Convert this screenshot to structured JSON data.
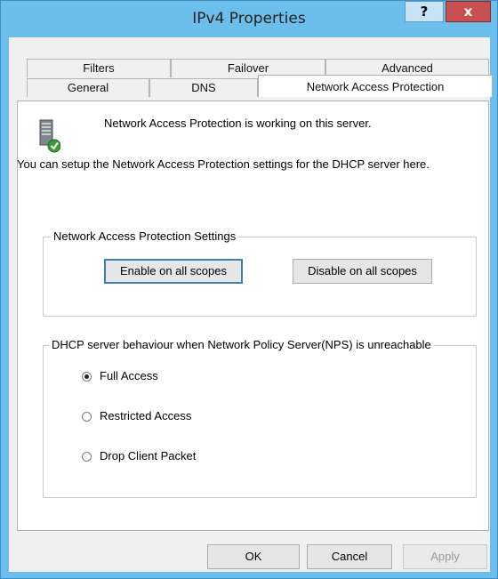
{
  "window": {
    "title": "IPv4 Properties",
    "help_label": "?",
    "close_label": "x"
  },
  "tabs": {
    "back": [
      {
        "label": "Filters"
      },
      {
        "label": "Failover"
      },
      {
        "label": "Advanced"
      }
    ],
    "front": [
      {
        "label": "General"
      },
      {
        "label": "DNS"
      },
      {
        "label": "Network Access Protection",
        "active": true
      }
    ]
  },
  "nap": {
    "status": "Network Access Protection is working on this server.",
    "description": "You can setup the Network Access Protection settings for the DHCP server here.",
    "settings_group": {
      "label": "Network Access Protection Settings",
      "enable_label": "Enable on all scopes",
      "disable_label": "Disable on all scopes"
    },
    "behaviour_group": {
      "label": "DHCP server behaviour when Network Policy Server(NPS) is unreachable",
      "options": [
        {
          "label": "Full Access",
          "selected": true
        },
        {
          "label": "Restricted Access",
          "selected": false
        },
        {
          "label": "Drop Client Packet",
          "selected": false
        }
      ]
    }
  },
  "footer": {
    "ok_label": "OK",
    "cancel_label": "Cancel",
    "apply_label": "Apply"
  },
  "icons": {
    "server": "server-check-icon"
  }
}
